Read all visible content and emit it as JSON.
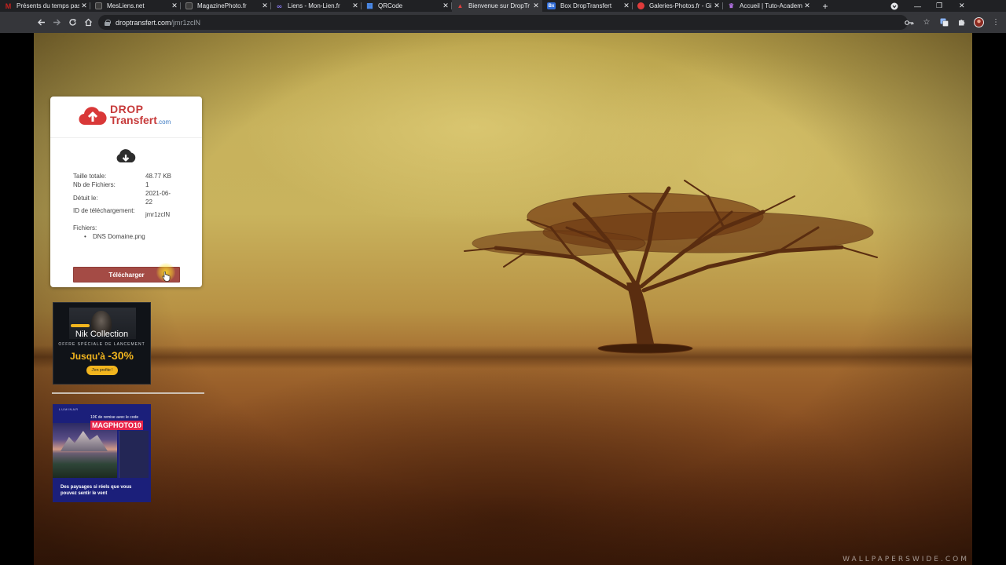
{
  "browser": {
    "tabs": [
      {
        "title": "Présents du temps pas",
        "favicon": "gmail-icon",
        "fav_color": "#c5221f",
        "fav_glyph": "M",
        "active": false
      },
      {
        "title": "MesLiens.net",
        "favicon": "page-icon",
        "fav_color": "#444",
        "fav_glyph": "",
        "active": false
      },
      {
        "title": "MagazinePhoto.fr",
        "favicon": "page-icon",
        "fav_color": "#444",
        "fav_glyph": "",
        "active": false
      },
      {
        "title": "Liens - Mon-Lien.fr",
        "favicon": "link-icon",
        "fav_color": "#7b6cf0",
        "fav_glyph": "∞",
        "active": false
      },
      {
        "title": "QRCode",
        "favicon": "qrcode-icon",
        "fav_color": "#2b6fd6",
        "fav_glyph": "▦",
        "active": false
      },
      {
        "title": "Bienvenue sur DropTr",
        "favicon": "droptransfert-icon",
        "fav_color": "#d93838",
        "fav_glyph": "▲",
        "active": true
      },
      {
        "title": "Box DropTransfert",
        "favicon": "box-icon",
        "fav_color": "#2f6bd6",
        "fav_glyph": "Bx",
        "active": false
      },
      {
        "title": "Galeries-Photos.fr - Gi",
        "favicon": "galeries-icon",
        "fav_color": "#e03b3b",
        "fav_glyph": "●",
        "active": false
      },
      {
        "title": "Accueil | Tuto-Academ",
        "favicon": "tuto-icon",
        "fav_color": "#7b3fb5",
        "fav_glyph": "♛",
        "active": false
      }
    ],
    "url_host": "droptransfert.com",
    "url_path": "/jmr1zclN"
  },
  "card": {
    "logo_line1": "DROP",
    "logo_line2": "Transfert",
    "logo_suffix": ".com",
    "fields": [
      {
        "label": "Taille totale:",
        "value": "48.77 KB"
      },
      {
        "label": "Nb de Fichiers:",
        "value": "1"
      },
      {
        "label": "Détuit le:",
        "value": "2021-06-22"
      },
      {
        "label": "ID de téléchargement:",
        "value": "jmr1zclN"
      }
    ],
    "files_label": "Fichiers:",
    "files": [
      "DNS Domaine.png"
    ],
    "download_label": "Télécharger"
  },
  "ads": {
    "ad1": {
      "title": "Nik Collection",
      "sub": "OFFRE SPÉCIALE DE LANCEMENT",
      "percent_prefix": "Jusqu'à",
      "percent": "-30%",
      "cta": "J'en profite !"
    },
    "ad2": {
      "brand": "LUMINAR",
      "promo": "10€ de remise avec le code",
      "code": "MAGPHOTO10",
      "copy": "Des paysages si réels que vous pouvez sentir le vent"
    }
  },
  "watermark": "WALLPAPERSWIDE.COM",
  "colors": {
    "brand_red": "#c73b3b",
    "button": "#a44b45",
    "chrome_dark": "#202124",
    "chrome_toolbar": "#35363a"
  }
}
